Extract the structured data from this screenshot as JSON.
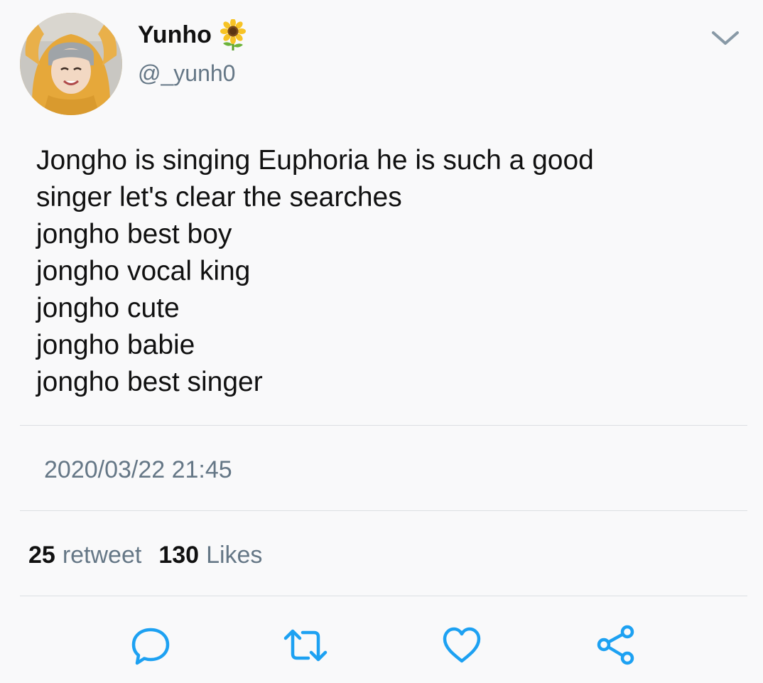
{
  "header": {
    "display_name": "Yunho",
    "name_emoji": "sunflower-icon",
    "handle": "@_yunh0"
  },
  "tweet": {
    "lines": [
      "Jongho is singing Euphoria he is such a good",
      "singer let's clear the searches",
      "jongho best boy",
      "jongho vocal king",
      "jongho cute",
      "jongho babie",
      "jongho best singer"
    ],
    "timestamp": "2020/03/22 21:45"
  },
  "stats": {
    "retweet_count": "25",
    "retweet_label": "retweet",
    "likes_count": "130",
    "likes_label": "Likes"
  },
  "actions": [
    "reply-icon",
    "retweet-icon",
    "heart-icon",
    "share-icon"
  ],
  "colors": {
    "background": "#f9f9fa",
    "text": "#111111",
    "secondary_text": "#657786",
    "divider": "#dcdfe3",
    "icon": "#1da1f2"
  }
}
